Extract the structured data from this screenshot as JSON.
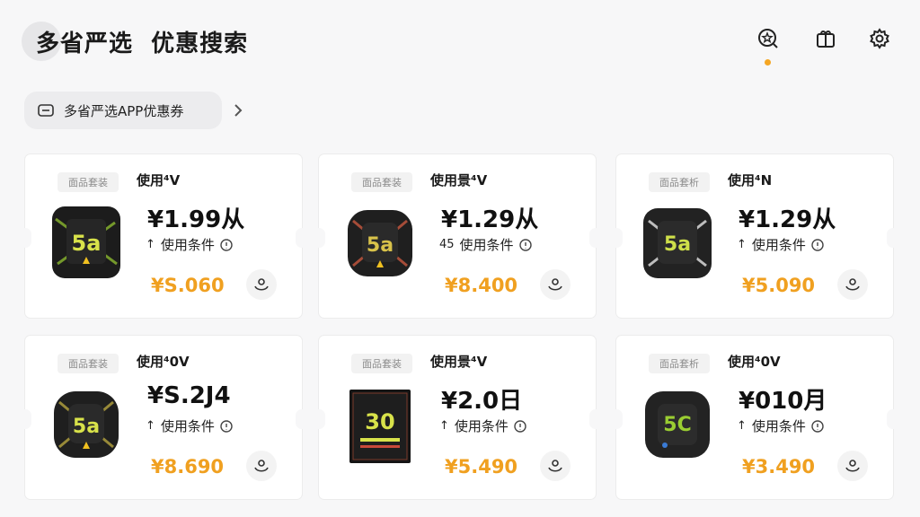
{
  "header": {
    "title": "多省严选  优惠搜索",
    "icons": [
      "search-star-icon",
      "gift-box-icon",
      "settings-gear-icon"
    ],
    "notification_dot_color": "#f5a623"
  },
  "coupon_pill": {
    "label": "多省严选APP优惠券"
  },
  "cards": [
    {
      "tag": "面品套装",
      "usage": "使用⁴V",
      "price": "¥1.99从",
      "condition": "使用条件",
      "condition_prefix": "↑",
      "final_price": "¥S.060",
      "badge": "5a"
    },
    {
      "tag": "面品套装",
      "usage": "使用景⁴V",
      "price": "¥1.29从",
      "condition": "使用条件",
      "condition_prefix": "45",
      "final_price": "¥8.400",
      "badge": "5a"
    },
    {
      "tag": "面品套析",
      "usage": "使用⁴N",
      "price": "¥1.29从",
      "condition": "使用条件",
      "condition_prefix": "↑",
      "final_price": "¥5.090",
      "badge": "5a"
    },
    {
      "tag": "面品套装",
      "usage": "使用⁴0V",
      "price": "¥S.2J4",
      "condition": "使用条件",
      "condition_prefix": "↑",
      "final_price": "¥8.690",
      "badge": "5a"
    },
    {
      "tag": "面品套装",
      "usage": "使用景⁴V",
      "price": "¥2.0日",
      "condition": "使用条件",
      "condition_prefix": "↑",
      "final_price": "¥5.490",
      "badge": "30"
    },
    {
      "tag": "面品套析",
      "usage": "使用⁴0V",
      "price": "¥010月",
      "condition": "使用条件",
      "condition_prefix": "↑",
      "final_price": "¥3.490",
      "badge": "5C"
    }
  ],
  "colors": {
    "accent": "#f0a020",
    "background": "#f7f7f8",
    "card": "#ffffff"
  }
}
